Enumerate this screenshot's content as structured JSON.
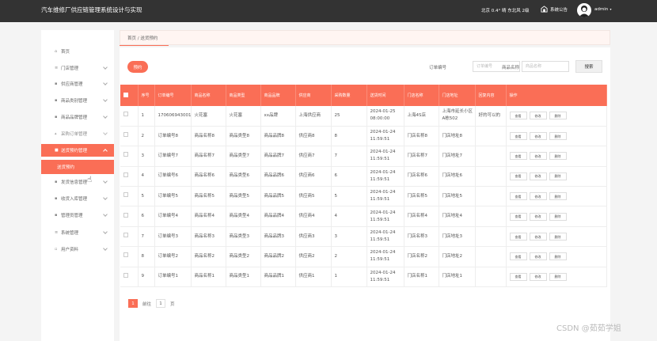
{
  "header": {
    "title": "汽车维修厂供应链管理系统设计与实现",
    "weather": "北京 0.4° 晴 东北风 2级",
    "notice_label": "系统公告",
    "username": "admin"
  },
  "sidebar": {
    "items": [
      {
        "label": "首页",
        "icon": "home-icon"
      },
      {
        "label": "门店管理",
        "icon": "list-icon"
      },
      {
        "label": "供应商管理",
        "icon": "grid-icon"
      },
      {
        "label": "商品类别管理",
        "icon": "grid-icon"
      },
      {
        "label": "商品品牌管理",
        "icon": "grid-icon"
      },
      {
        "label": "采购订单管理",
        "icon": "cart-icon"
      },
      {
        "label": "送货预约管理",
        "icon": "folder-icon"
      },
      {
        "label": "送货预约",
        "icon": ""
      },
      {
        "label": "发货信息管理",
        "icon": "grid-icon"
      },
      {
        "label": "收货入库管理",
        "icon": "grid-icon"
      },
      {
        "label": "管理员管理",
        "icon": "person-icon"
      },
      {
        "label": "系统管理",
        "icon": "list-icon"
      },
      {
        "label": "用户资料",
        "icon": "doc-icon"
      }
    ]
  },
  "breadcrumb": "首页 / 送货预约",
  "toolbar": {
    "add_label": "预约",
    "order_no_label": "订单编号",
    "order_no_placeholder": "订单编号",
    "product_name_label": "商品名称",
    "product_name_placeholder": "商品名称",
    "search_label": "搜索"
  },
  "table": {
    "headers": [
      "",
      "序号",
      "订单编号",
      "商品名称",
      "商品类型",
      "商品品牌",
      "供应商",
      "采购数量",
      "送货时间",
      "门店名称",
      "门店地址",
      "回复内容",
      "操作"
    ],
    "op_labels": [
      "查看",
      "修改",
      "删除"
    ],
    "rows": [
      [
        "1",
        "1706069430015",
        "火花塞",
        "火花塞",
        "xx品牌",
        "上海供应商",
        "25",
        "2024-01-25 08:00:00",
        "上海4S店",
        "上海市延长小区A栋502",
        "好的可以的"
      ],
      [
        "2",
        "订单编号8",
        "商品名称8",
        "商品类型8",
        "商品品牌8",
        "供应商8",
        "8",
        "2024-01-24 11:59:51",
        "门店名称8",
        "门店地址8",
        ""
      ],
      [
        "3",
        "订单编号7",
        "商品名称7",
        "商品类型7",
        "商品品牌7",
        "供应商7",
        "7",
        "2024-01-24 11:59:51",
        "门店名称7",
        "门店地址7",
        ""
      ],
      [
        "4",
        "订单编号6",
        "商品名称6",
        "商品类型6",
        "商品品牌6",
        "供应商6",
        "6",
        "2024-01-24 11:59:51",
        "门店名称6",
        "门店地址6",
        ""
      ],
      [
        "5",
        "订单编号5",
        "商品名称5",
        "商品类型5",
        "商品品牌5",
        "供应商5",
        "5",
        "2024-01-24 11:59:51",
        "门店名称5",
        "门店地址5",
        ""
      ],
      [
        "6",
        "订单编号4",
        "商品名称4",
        "商品类型4",
        "商品品牌4",
        "供应商4",
        "4",
        "2024-01-24 11:59:51",
        "门店名称4",
        "门店地址4",
        ""
      ],
      [
        "7",
        "订单编号3",
        "商品名称3",
        "商品类型3",
        "商品品牌3",
        "供应商3",
        "3",
        "2024-01-24 11:59:51",
        "门店名称3",
        "门店地址3",
        ""
      ],
      [
        "8",
        "订单编号2",
        "商品名称2",
        "商品类型2",
        "商品品牌2",
        "供应商2",
        "2",
        "2024-01-24 11:59:51",
        "门店名称2",
        "门店地址2",
        ""
      ],
      [
        "9",
        "订单编号1",
        "商品名称1",
        "商品类型1",
        "商品品牌1",
        "供应商1",
        "1",
        "2024-01-24 11:59:51",
        "门店名称1",
        "门店地址1",
        ""
      ]
    ]
  },
  "pagination": {
    "current": "1",
    "goto_label": "前往",
    "goto_value": "1",
    "page_suffix": "页"
  },
  "watermark": "CSDN @茹茹学姐",
  "colors": {
    "accent": "#fa6e56",
    "topbar": "#333333"
  }
}
